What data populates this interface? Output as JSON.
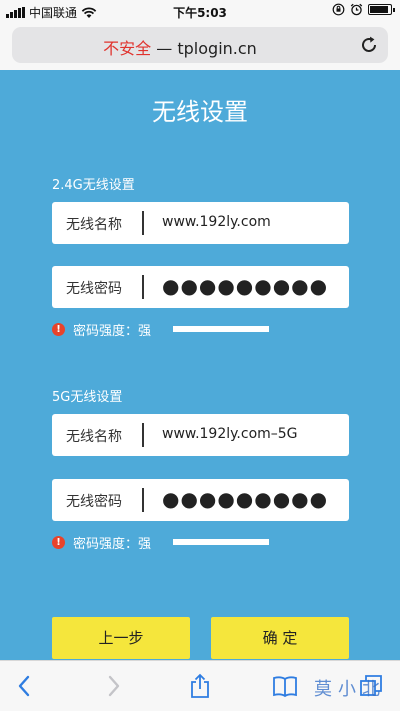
{
  "status_bar": {
    "carrier": "中国联通",
    "time": "下午5:03"
  },
  "address_bar": {
    "insecure_label": "不安全",
    "separator": "—",
    "domain": "tplogin.cn"
  },
  "page": {
    "title": "无线设置",
    "band_24": {
      "section_label": "2.4G无线设置",
      "ssid_label": "无线名称",
      "ssid_value": "www.192ly.com",
      "password_label": "无线密码",
      "password_value": "●●●●●●●●●",
      "strength_text": "密码强度：强"
    },
    "band_5": {
      "section_label": "5G无线设置",
      "ssid_label": "无线名称",
      "ssid_value": "www.192ly.com–5G",
      "password_label": "无线密码",
      "password_value": "●●●●●●●●●",
      "strength_text": "密码强度：强"
    },
    "buttons": {
      "prev": "上一步",
      "confirm": "确 定"
    }
  },
  "watermark": "莫小北",
  "colors": {
    "page_background": "#4eaad9",
    "button": "#f5e63c",
    "insecure": "#e0332e",
    "warning": "#e8432b"
  }
}
